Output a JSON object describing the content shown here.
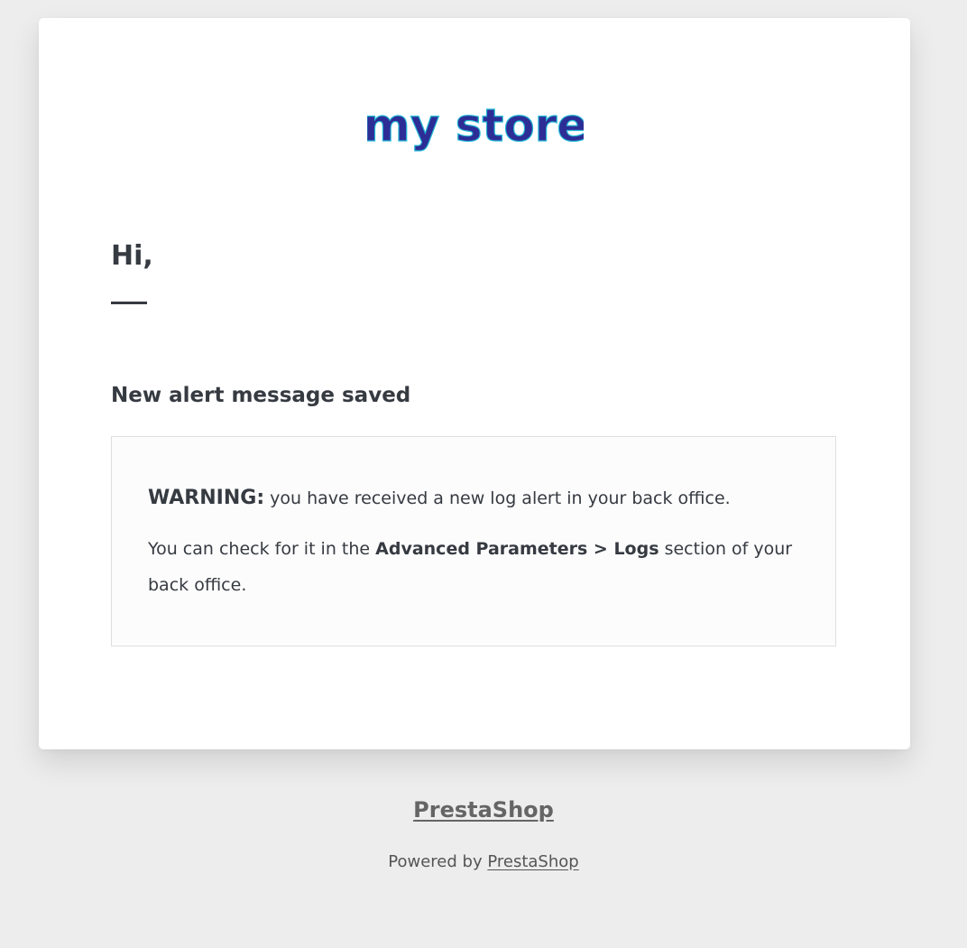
{
  "logo": {
    "text": "my store",
    "icon": "my-store-logo",
    "colors": [
      "#25b9d7",
      "#1d1d8f",
      "#e84b5a",
      "#363a41"
    ]
  },
  "email": {
    "greeting": "Hi,",
    "subtitle": "New alert message saved",
    "warning_label": "WARNING:",
    "warning_text": " you have received a new log alert in your back office.",
    "check_prefix": "You can check for it in the ",
    "check_path": "Advanced Parameters > Logs",
    "check_suffix": " section of your back office."
  },
  "footer": {
    "brand_link": "PrestaShop",
    "powered_prefix": "Powered by ",
    "powered_link": "PrestaShop"
  }
}
